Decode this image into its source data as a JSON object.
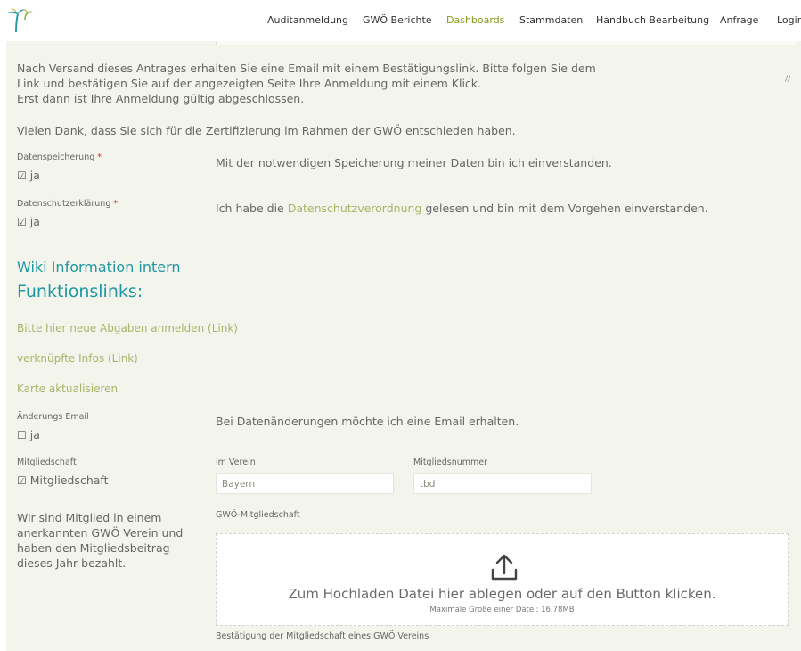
{
  "nav": {
    "items": [
      {
        "label": "Auditanmeldung",
        "active": false
      },
      {
        "label": "GWÖ Berichte",
        "active": false
      },
      {
        "label": "Dashboards",
        "active": true
      },
      {
        "label": "Stammdaten",
        "active": false
      },
      {
        "label": "Handbuch Bearbeitung",
        "active": false
      },
      {
        "label": "Anfrage",
        "active": false
      },
      {
        "label": "Login",
        "active": false
      }
    ],
    "active_color": "#8a9a1e"
  },
  "corner_mark": "//",
  "intro": {
    "line1": "Nach Versand dieses Antrages erhalten Sie eine Email mit einem Bestätigungslink. Bitte folgen Sie dem",
    "line2": "Link und bestätigen Sie auf der angezeigten Seite Ihre Anmeldung mit einem Klick.",
    "line3": "Erst dann ist Ihre Anmeldung gültig abgeschlossen.",
    "thanks": "Vielen Dank, dass Sie sich für die Zertifizierung im Rahmen der GWÖ entschieden haben."
  },
  "datenspeicherung": {
    "label": "Datenspeicherung",
    "required_mark": "*",
    "checkbox_label": "ja",
    "checked": true,
    "text": "Mit der notwendigen Speicherung meiner Daten bin ich einverstanden."
  },
  "datenschutz": {
    "label": "Datenschutzerklärung",
    "required_mark": "*",
    "checkbox_label": "ja",
    "checked": true,
    "text_before": "Ich habe die ",
    "link": "Datenschutzverordnung",
    "text_after": " gelesen und bin mit dem Vorgehen einverstanden."
  },
  "wiki_heading": "Wiki Information intern",
  "funktionslinks_heading": "Funktionslinks:",
  "links": [
    "Bitte hier neue Abgaben anmelden (Link)",
    "verknüpfte Infos (Link)",
    "Karte aktualisieren"
  ],
  "aenderungs_email": {
    "label": "Änderungs Email",
    "checkbox_label": "ja",
    "checked": false,
    "text": "Bei Datenänderungen möchte ich eine Email erhalten."
  },
  "mitgliedschaft": {
    "label": "Mitgliedschaft",
    "checkbox_label": "Mitgliedschaft",
    "checked": true,
    "verein_label": "im Verein",
    "verein_value": "Bayern",
    "nummer_label": "Mitgliedsnummer",
    "nummer_value": "tbd",
    "note_lines": [
      "Wir sind Mitglied in einem",
      "anerkannten GWÖ Verein und",
      "haben den Mitgliedsbeitrag",
      "dieses Jahr bezahlt."
    ]
  },
  "upload": {
    "label": "GWÖ-Mitgliedschaft",
    "icon": "upload-icon",
    "text": "Zum Hochladen Datei hier ablegen oder auf den Button klicken.",
    "max_size": "Maximale Größe einer Datei: 16.78MB",
    "hint": "Bestätigung der Mitgliedschaft eines GWÖ Vereins"
  },
  "colors": {
    "panel_bg": "#f3f4ec",
    "heading_teal": "#1e97a1",
    "link_green": "#a9b46a",
    "required_red": "#d12a2a"
  }
}
